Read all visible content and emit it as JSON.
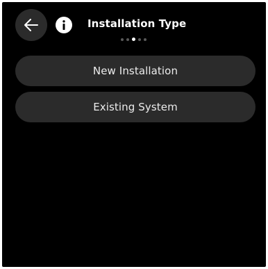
{
  "header": {
    "title": "Installation Type",
    "back_icon": "arrow-left-icon",
    "info_icon": "info-icon",
    "steps_total": 5,
    "active_step": 3
  },
  "options": [
    {
      "label": "New Installation"
    },
    {
      "label": "Existing System"
    }
  ],
  "colors": {
    "background": "#000000",
    "button_fill": "#2b2b2b",
    "text": "#ffffff",
    "dot_inactive": "#5a5a5a",
    "dot_active": "#ffffff"
  }
}
